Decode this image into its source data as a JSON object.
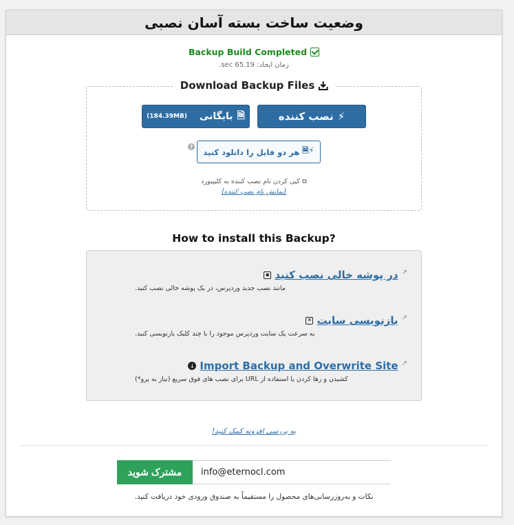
{
  "header": {
    "title": "وضعیت ساخت بسته آسان نصبی"
  },
  "status": {
    "text": "Backup Build Completed",
    "build_time": "زمان ایجاد: 65.19 sec."
  },
  "download": {
    "legend": "Download Backup Files",
    "installer_label": "نصب کننده",
    "archive_label": "بایگانی",
    "archive_size": "(184.39MB)",
    "both_label": "هر دو فایل را دانلود کنید",
    "help": "?",
    "copy_text": "کپی کردن نام نصب کننده به کلیپبورد",
    "show_name": "[نمایش نام نصب کننده]"
  },
  "install": {
    "title": "How to install this Backup?",
    "options": [
      {
        "title": "در پوشه خالی نصب کنید",
        "desc": "مانند نصب جدید وردپرس، در یک پوشه خالی نصب کنید.",
        "icon": "save-icon"
      },
      {
        "title": "بازنویسی سایت",
        "desc": "به سرعت یک سایت وردپرس موجود را با چند کلیک بازنویسی کنید.",
        "icon": "overwrite-icon"
      },
      {
        "title": "Import Backup and Overwrite Site",
        "desc": "کشیدن و رها کردن یا استفاده از URL برای نصب های فوق سریع (نیاز به پرو*)",
        "icon": "import-icon"
      }
    ]
  },
  "feedback": {
    "text": "به بررسی افزونه کمک کنید!"
  },
  "subscribe": {
    "button": "مشترک شوید",
    "email_value": "info@eternocl.com",
    "tips": "نکات و به‌روزرسانی‌های محصول را مستقیماً به صندوق ورودی خود دریافت کنید."
  },
  "colors": {
    "primary": "#2e6da4",
    "success": "#1e8b1e",
    "subscribe": "#2ea25a"
  }
}
